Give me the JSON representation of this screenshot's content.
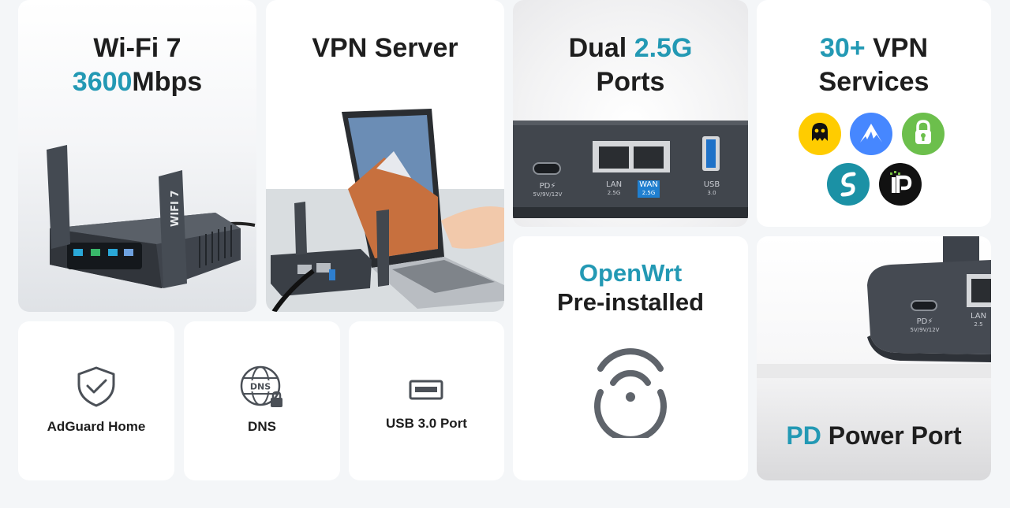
{
  "cards": {
    "wifi": {
      "line1": "Wi-Fi 7",
      "speed_accent": "3600",
      "speed_unit": "Mbps",
      "antenna_text": "WIFI 7"
    },
    "vpn_server": {
      "title": "VPN Server"
    },
    "ports": {
      "title_prefix": "Dual ",
      "title_accent": "2.5G",
      "title_line2": "Ports",
      "labels": [
        {
          "name": "PD",
          "sub": "5V/9V/12V"
        },
        {
          "name": "LAN",
          "sub": "2.5G"
        },
        {
          "name": "WAN",
          "sub": "2.5G"
        },
        {
          "name": "USB",
          "sub": "3.0"
        }
      ],
      "pd_symbol": "⚡"
    },
    "vpn_services": {
      "accent": "30+",
      "title_rest": " VPN",
      "line2": "Services"
    },
    "adguard": {
      "label": "AdGuard Home"
    },
    "dns": {
      "label": "DNS",
      "icon_text": "DNS"
    },
    "usb": {
      "label": "USB 3.0 Port"
    },
    "openwrt": {
      "accent": "OpenWrt",
      "line2": "Pre-installed"
    },
    "pd_power": {
      "accent": "PD",
      "title_rest": " Power Port",
      "pd_port": {
        "name": "PD",
        "symbol": "⚡",
        "sub": "5V/9V/12V"
      },
      "lan_port": {
        "name": "LAN",
        "sub": "2.5"
      }
    }
  },
  "colors": {
    "accent": "#2399b4",
    "text": "#1e1e1e",
    "background": "#f4f6f8",
    "card": "#ffffff",
    "device": "#4a4f57"
  },
  "vpn_logos": [
    {
      "name": "cyberghost",
      "color": "#ffcc00"
    },
    {
      "name": "nordvpn",
      "color": "#4687ff"
    },
    {
      "name": "private-internet-access",
      "color": "#6cbf4c"
    },
    {
      "name": "surfshark",
      "color": "#1b91a5"
    },
    {
      "name": "ipvanish",
      "color": "#111111"
    }
  ]
}
